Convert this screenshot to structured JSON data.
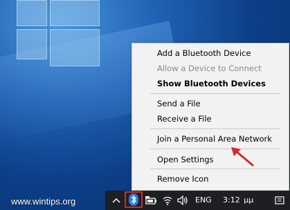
{
  "watermark": "www.wintips.org",
  "context_menu": {
    "items": [
      {
        "label": "Add a Bluetooth Device",
        "state": "normal"
      },
      {
        "label": "Allow a Device to Connect",
        "state": "disabled"
      },
      {
        "label": "Show Bluetooth Devices",
        "state": "bold"
      },
      {
        "label": "Send a File",
        "state": "normal"
      },
      {
        "label": "Receive a File",
        "state": "normal"
      },
      {
        "label": "Join a Personal Area Network",
        "state": "normal"
      },
      {
        "label": "Open Settings",
        "state": "normal"
      },
      {
        "label": "Remove Icon",
        "state": "normal"
      }
    ]
  },
  "taskbar": {
    "language": "ENG",
    "time": "3:12",
    "time_suffix": "μμ",
    "icons": [
      "chevron-up-icon",
      "bluetooth-icon",
      "battery-icon",
      "wifi-icon",
      "volume-icon",
      "notification-icon"
    ]
  },
  "colors": {
    "highlight_box": "#d22b2b",
    "arrow": "#d22b2b",
    "menu_bg": "#f2f2f2",
    "taskbar_bg": "#1e1f22",
    "bluetooth_badge": "#2e7bd6"
  }
}
